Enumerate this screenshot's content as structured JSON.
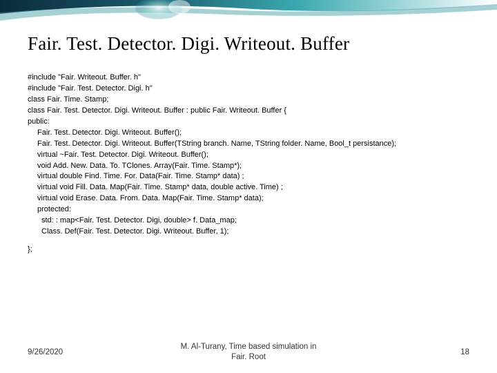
{
  "title": "Fair. Test. Detector. Digi. Writeout. Buffer",
  "code": {
    "l0": "#include \"Fair. Writeout. Buffer. h\"",
    "l1": "#include \"Fair. Test. Detector. Digi. h\"",
    "l2": "class Fair. Time. Stamp;",
    "l3": "class Fair. Test. Detector. Digi. Writeout. Buffer : public Fair. Writeout. Buffer {",
    "l4": "public:",
    "l5": "Fair. Test. Detector. Digi. Writeout. Buffer();",
    "l6": "Fair. Test. Detector. Digi. Writeout. Buffer(TString branch. Name, TString folder. Name, Bool_t persistance);",
    "l7": "virtual ~Fair. Test. Detector. Digi. Writeout. Buffer();",
    "l8": "void Add. New. Data. To. TClones. Array(Fair. Time. Stamp*);",
    "l9": "virtual double Find. Time. For. Data(Fair. Time. Stamp* data) ;",
    "l10": "virtual void Fill. Data. Map(Fair. Time. Stamp* data, double active. Time) ;",
    "l11": "virtual void Erase. Data. From. Data. Map(Fair. Time. Stamp* data);",
    "l12": "protected:",
    "l13": "std: : map<Fair. Test. Detector. Digi, double> f. Data_map;",
    "l14": "Class. Def(Fair. Test. Detector. Digi. Writeout. Buffer, 1);",
    "l15": "};"
  },
  "footer": {
    "date": "9/26/2020",
    "center_line1": "M. Al-Turany, Time based simulation in",
    "center_line2": "Fair. Root",
    "page": "18"
  }
}
